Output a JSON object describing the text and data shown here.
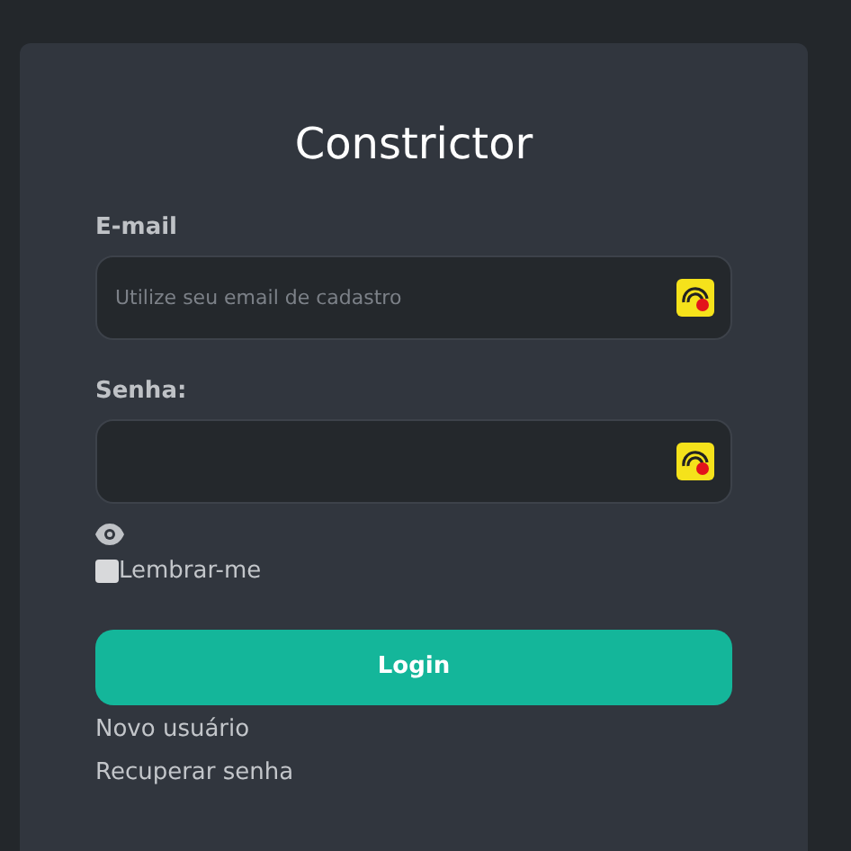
{
  "title": "Constrictor",
  "fields": [
    {
      "label": "E-mail",
      "placeholder": "Utilize seu email de cadastro",
      "kind": "email"
    },
    {
      "label": "Senha:",
      "kind": "password"
    }
  ],
  "remember": {
    "label": "Lembrar-me",
    "checked": false
  },
  "login_button": "Login",
  "links": [
    "Novo usuário",
    "Recuperar senha"
  ]
}
